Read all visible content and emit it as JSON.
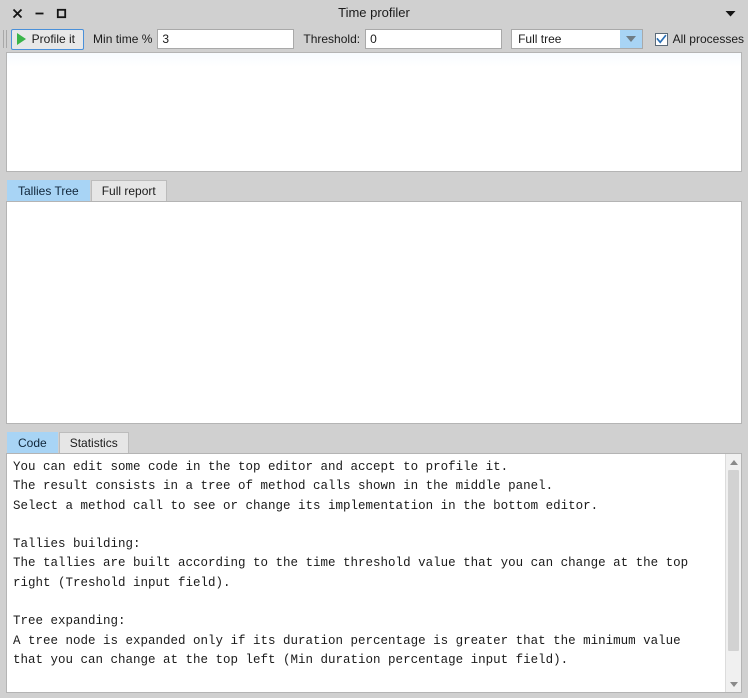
{
  "window": {
    "title": "Time profiler",
    "controls": {
      "close": "close-icon",
      "minimize": "minimize-icon",
      "maximize": "maximize-icon",
      "menu": "triangle-down-icon"
    }
  },
  "toolbar": {
    "profile_button": "Profile it",
    "min_time_label": "Min time %",
    "min_time_value": "3",
    "threshold_label": "Threshold:",
    "threshold_value": "0",
    "scope_selected": "Full tree",
    "scope_options": [
      "Full tree"
    ],
    "all_processes_label": "All processes",
    "all_processes_checked": true
  },
  "tallies_tabs": {
    "items": [
      {
        "label": "Tallies Tree",
        "active": true
      },
      {
        "label": "Full report",
        "active": false
      }
    ]
  },
  "code_tabs": {
    "items": [
      {
        "label": "Code",
        "active": true
      },
      {
        "label": "Statistics",
        "active": false
      }
    ]
  },
  "top_editor": {
    "content": ""
  },
  "tallies_panel": {
    "content": ""
  },
  "code_panel": {
    "content": "You can edit some code in the top editor and accept to profile it.\nThe result consists in a tree of method calls shown in the middle panel.\nSelect a method call to see or change its implementation in the bottom editor.\n\nTallies building:\nThe tallies are built according to the time threshold value that you can change at the top\nright (Treshold input field).\n\nTree expanding:\nA tree node is expanded only if its duration percentage is greater that the minimum value\nthat you can change at the top left (Min duration percentage input field)."
  },
  "colors": {
    "window_bg": "#d0d0d0",
    "accent_blue": "#a8d4f5",
    "focus_blue": "#4a90d9",
    "play_green": "#3bb54a",
    "panel_white": "#ffffff"
  }
}
